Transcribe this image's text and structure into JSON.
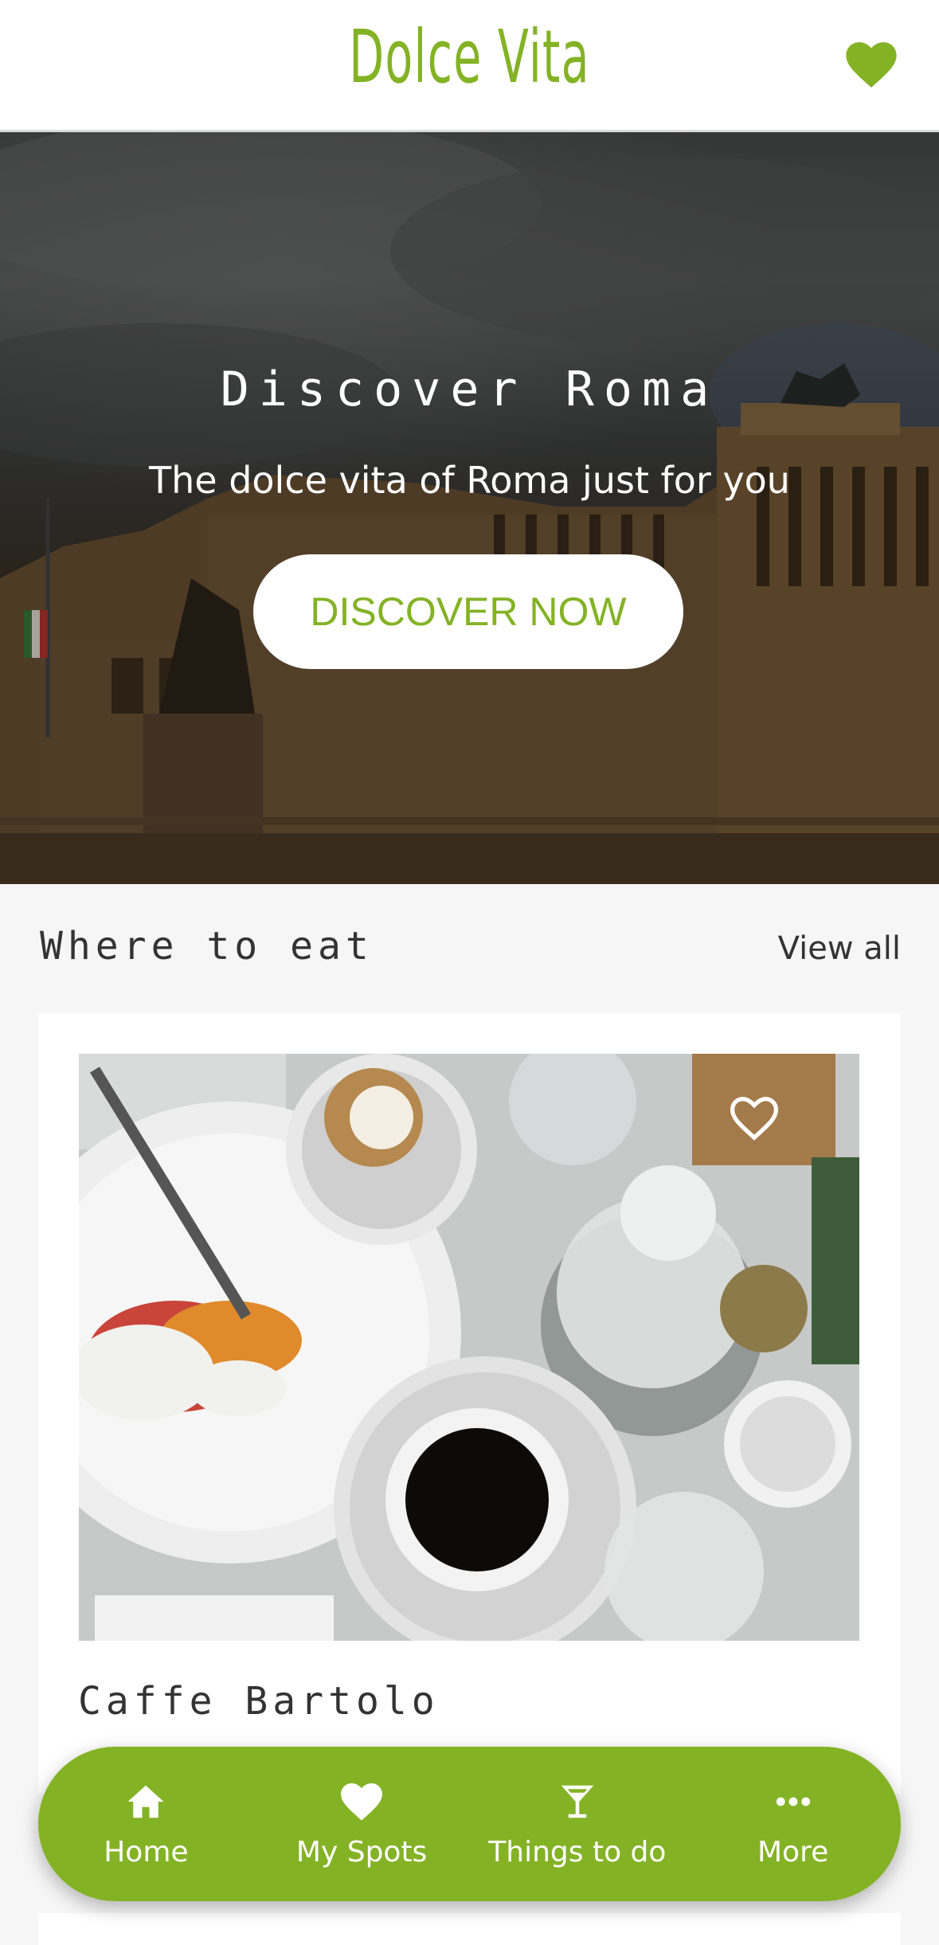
{
  "header": {
    "logo": "Dolce Vita",
    "favorites_icon": "heart-icon"
  },
  "hero": {
    "title": "Discover Roma",
    "subtitle": "The dolce vita of Roma just for you",
    "cta_label": "DISCOVER NOW"
  },
  "section": {
    "title": "Where to eat",
    "view_all": "View all"
  },
  "cards": [
    {
      "title": "Caffe Bartolo",
      "favorite_icon": "heart-outline-icon"
    }
  ],
  "nav": {
    "items": [
      {
        "label": "Home",
        "icon": "home-icon"
      },
      {
        "label": "My Spots",
        "icon": "heart-icon"
      },
      {
        "label": "Things to do",
        "icon": "cocktail-icon"
      },
      {
        "label": "More",
        "icon": "more-icon"
      }
    ]
  },
  "colors": {
    "brand": "#84b225",
    "background": "#f6f6f6",
    "card": "#ffffff",
    "text": "#333333"
  }
}
